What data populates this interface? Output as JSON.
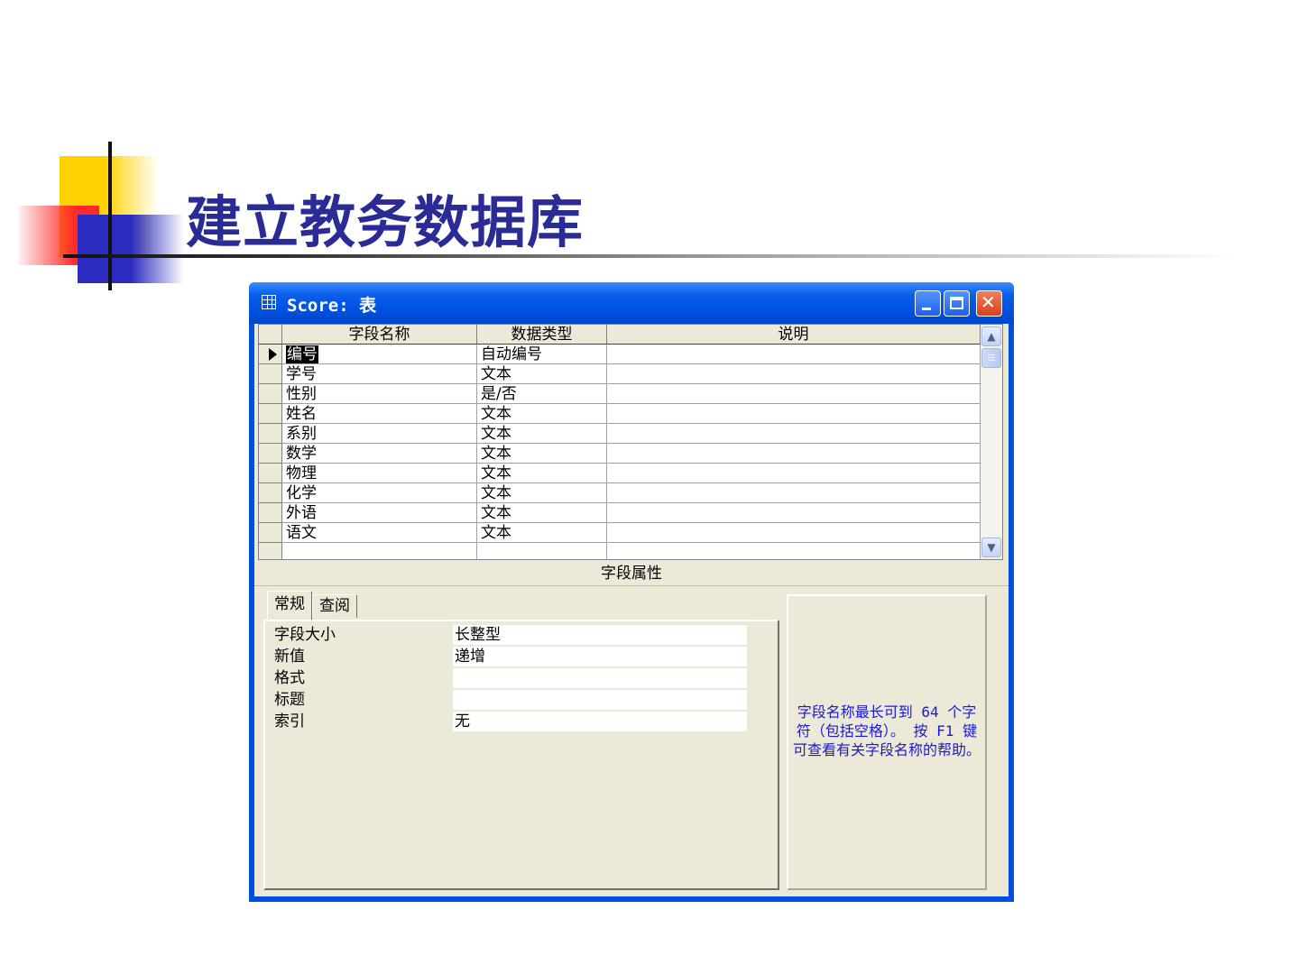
{
  "slide": {
    "title": "建立教务数据库"
  },
  "window": {
    "title": "Score: 表",
    "minimize_icon": "minimize-icon",
    "maximize_icon": "maximize-icon",
    "close_icon": "close-icon"
  },
  "grid": {
    "headers": [
      "字段名称",
      "数据类型",
      "说明"
    ],
    "rows": [
      {
        "name": "编号",
        "type": "自动编号",
        "desc": ""
      },
      {
        "name": "学号",
        "type": "文本",
        "desc": ""
      },
      {
        "name": "性别",
        "type": "是/否",
        "desc": ""
      },
      {
        "name": "姓名",
        "type": "文本",
        "desc": ""
      },
      {
        "name": "系别",
        "type": "文本",
        "desc": ""
      },
      {
        "name": "数学",
        "type": "文本",
        "desc": ""
      },
      {
        "name": "物理",
        "type": "文本",
        "desc": ""
      },
      {
        "name": "化学",
        "type": "文本",
        "desc": ""
      },
      {
        "name": "外语",
        "type": "文本",
        "desc": ""
      },
      {
        "name": "语文",
        "type": "文本",
        "desc": ""
      },
      {
        "name": "",
        "type": "",
        "desc": ""
      }
    ]
  },
  "properties": {
    "heading": "字段属性",
    "tabs": [
      "常规",
      "查阅"
    ],
    "items": [
      {
        "label": "字段大小",
        "value": "长整型"
      },
      {
        "label": "新值",
        "value": "递增"
      },
      {
        "label": "格式",
        "value": ""
      },
      {
        "label": "标题",
        "value": ""
      },
      {
        "label": "索引",
        "value": "无"
      }
    ],
    "help_text": "字段名称最长可到 64 个字符（包括空格）。 按 F1 键可查看有关字段名称的帮助。"
  }
}
